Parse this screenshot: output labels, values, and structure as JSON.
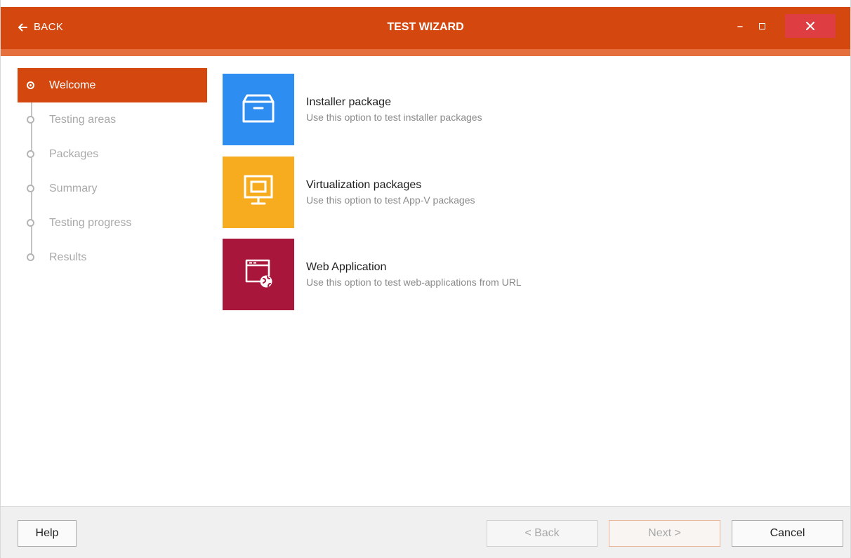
{
  "window": {
    "title": "TEST WIZARD",
    "back_label": "BACK",
    "accent_color": "#d4470f"
  },
  "steps": [
    {
      "label": "Welcome",
      "state": "active"
    },
    {
      "label": "Testing areas",
      "state": "pending"
    },
    {
      "label": "Packages",
      "state": "pending"
    },
    {
      "label": "Summary",
      "state": "pending"
    },
    {
      "label": "Testing progress",
      "state": "pending"
    },
    {
      "label": "Results",
      "state": "pending"
    }
  ],
  "options": [
    {
      "title": "Installer package",
      "description": "Use this option to test installer packages",
      "icon": "package-box-icon",
      "color": "#2d8df0"
    },
    {
      "title": "Virtualization packages",
      "description": "Use this option to test App-V packages",
      "icon": "monitor-icon",
      "color": "#f7ac1f"
    },
    {
      "title": "Web Application",
      "description": "Use this option to test web-applications from URL",
      "icon": "web-app-globe-icon",
      "color": "#a8163b"
    }
  ],
  "footer": {
    "help_label": "Help",
    "back_label": "< Back",
    "next_label": "Next >",
    "cancel_label": "Cancel"
  }
}
